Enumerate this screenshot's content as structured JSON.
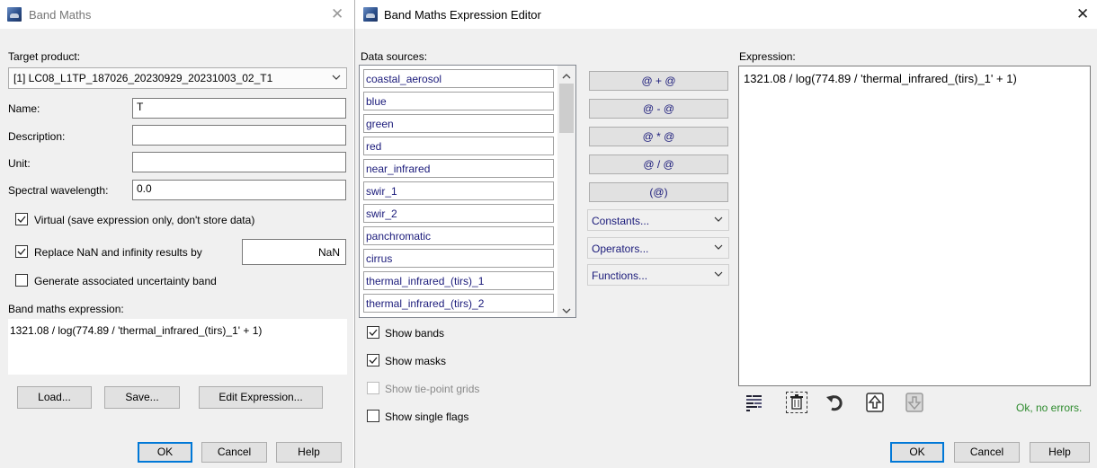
{
  "band_maths": {
    "title": "Band Maths",
    "target_product_label": "Target product:",
    "target_product_value": "[1] LC08_L1TP_187026_20230929_20231003_02_T1",
    "name_label": "Name:",
    "name_value": "T",
    "description_label": "Description:",
    "description_value": "",
    "unit_label": "Unit:",
    "unit_value": "",
    "spectral_label": "Spectral wavelength:",
    "spectral_value": "0.0",
    "virtual_label": "Virtual (save expression only, don't store data)",
    "virtual_checked": true,
    "replace_nan_label": "Replace NaN and infinity results by",
    "replace_nan_checked": true,
    "replace_nan_value": "NaN",
    "uncertainty_label": "Generate associated uncertainty band",
    "uncertainty_checked": false,
    "expression_label": "Band maths expression:",
    "expression_value": "1321.08 / log(774.89 / 'thermal_infrared_(tirs)_1' + 1)",
    "load_label": "Load...",
    "save_label": "Save...",
    "edit_label": "Edit Expression...",
    "ok_label": "OK",
    "cancel_label": "Cancel",
    "help_label": "Help"
  },
  "editor": {
    "title": "Band Maths Expression Editor",
    "data_sources_label": "Data sources:",
    "data_sources": [
      "coastal_aerosol",
      "blue",
      "green",
      "red",
      "near_infrared",
      "swir_1",
      "swir_2",
      "panchromatic",
      "cirrus",
      "thermal_infrared_(tirs)_1",
      "thermal_infrared_(tirs)_2"
    ],
    "operators": [
      "@ + @",
      "@ - @",
      "@ * @",
      "@ / @",
      "(@)"
    ],
    "constants_label": "Constants...",
    "operators_label": "Operators...",
    "functions_label": "Functions...",
    "show_bands_label": "Show bands",
    "show_bands_checked": true,
    "show_masks_label": "Show masks",
    "show_masks_checked": true,
    "show_tiepoint_label": "Show tie-point grids",
    "show_tiepoint_checked": false,
    "show_flags_label": "Show single flags",
    "show_flags_checked": false,
    "expression_label": "Expression:",
    "expression_value": "1321.08 / log(774.89 / 'thermal_infrared_(tirs)_1' + 1)",
    "status": "Ok, no errors.",
    "ok_label": "OK",
    "cancel_label": "Cancel",
    "help_label": "Help"
  },
  "colors": {
    "status_ok": "#2e8b2e",
    "list_text": "#1a1a7a",
    "primary_border": "#0078d7"
  }
}
